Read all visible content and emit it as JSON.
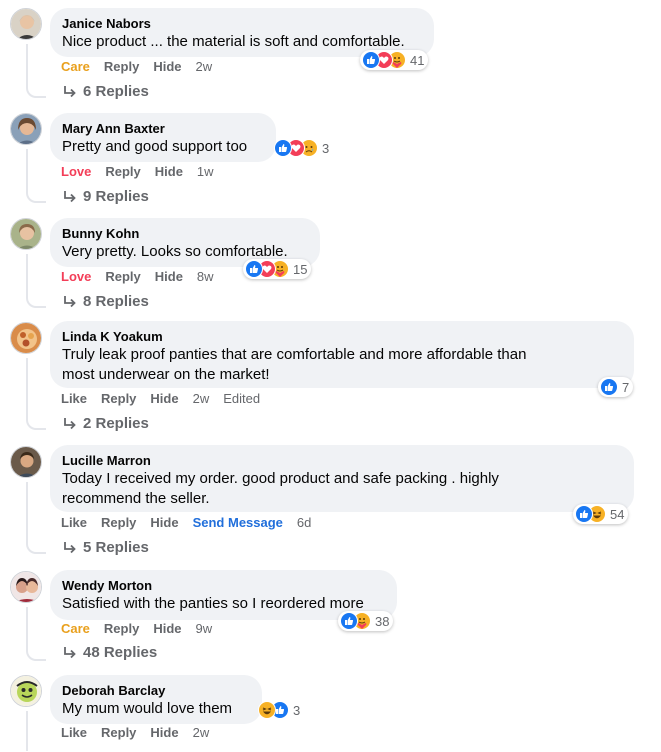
{
  "icons": {
    "reply_arrow": "reply-arrow-icon",
    "like": "like-reaction-icon",
    "love": "love-reaction-icon",
    "care": "care-reaction-icon",
    "haha": "haha-reaction-icon",
    "sad": "sad-reaction-icon"
  },
  "colors": {
    "bubble_bg": "#f0f2f5",
    "secondary_text": "#65676b",
    "like_blue": "#1877f2",
    "love_red": "#f33e58",
    "care_yellow": "#e9a01d",
    "link_blue": "#216fdb"
  },
  "comments": [
    {
      "author": "Janice Nabors",
      "text": "Nice product ... the material is soft and comfortable.",
      "reaction_label": "Care",
      "reply_label": "Reply",
      "hide_label": "Hide",
      "time": "2w",
      "reaction_icons": [
        "like",
        "love",
        "care"
      ],
      "reaction_count": "41",
      "replies_label": "6 Replies"
    },
    {
      "author": "Mary Ann Baxter",
      "text": "Pretty and good support too",
      "reaction_label": "Love",
      "reply_label": "Reply",
      "hide_label": "Hide",
      "time": "1w",
      "reaction_icons": [
        "like",
        "love",
        "sad"
      ],
      "reaction_count": "3",
      "replies_label": "9 Replies"
    },
    {
      "author": "Bunny Kohn",
      "text": "Very pretty. Looks so comfortable.",
      "reaction_label": "Love",
      "reply_label": "Reply",
      "hide_label": "Hide",
      "time": "8w",
      "reaction_icons": [
        "like",
        "love",
        "care"
      ],
      "reaction_count": "15",
      "replies_label": "8 Replies"
    },
    {
      "author": "Linda K Yoakum",
      "text_line1": "Truly leak proof panties that are comfortable and more affordable than",
      "text_line2": "most underwear on the market!",
      "reaction_label": "Like",
      "reply_label": "Reply",
      "hide_label": "Hide",
      "time": "2w",
      "edited_label": "Edited",
      "reaction_icons": [
        "like"
      ],
      "reaction_count": "7",
      "replies_label": "2 Replies"
    },
    {
      "author": "Lucille Marron",
      "text_line1": "Today I received my order. good product and safe packing . highly",
      "text_line2": "recommend the seller.",
      "reaction_label": "Like",
      "reply_label": "Reply",
      "hide_label": "Hide",
      "send_message_label": "Send Message",
      "time": "6d",
      "reaction_icons": [
        "like",
        "haha"
      ],
      "reaction_count": "54",
      "replies_label": "5 Replies"
    },
    {
      "author": "Wendy Morton",
      "text": "Satisfied with the panties so I reordered more",
      "reaction_label": "Care",
      "reply_label": "Reply",
      "hide_label": "Hide",
      "time": "9w",
      "reaction_icons": [
        "like",
        "care"
      ],
      "reaction_count": "38",
      "replies_label": "48 Replies"
    },
    {
      "author": "Deborah Barclay",
      "text": "My mum would love them",
      "reaction_label": "Like",
      "reply_label": "Reply",
      "hide_label": "Hide",
      "time": "2w",
      "reaction_icons": [
        "haha",
        "like"
      ],
      "reaction_count": "3"
    }
  ]
}
